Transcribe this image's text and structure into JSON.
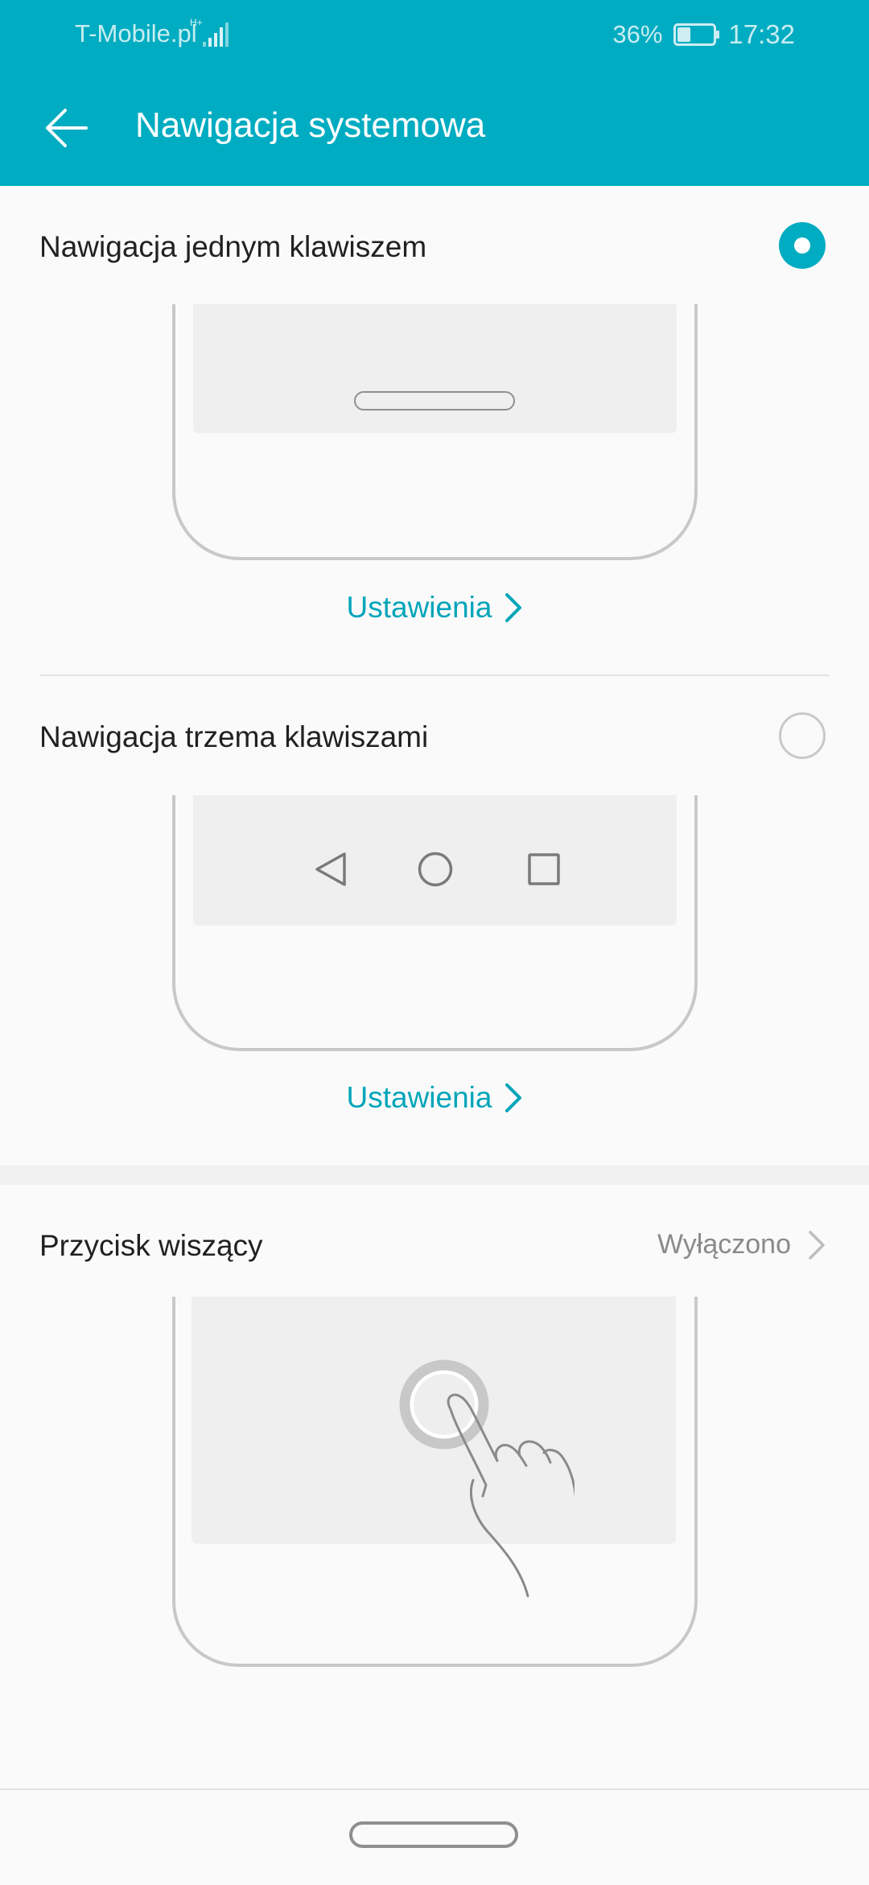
{
  "status_bar": {
    "carrier": "T-Mobile.pl",
    "network_type": "H+",
    "battery_percent": "36%",
    "battery_level": 0.36,
    "time": "17:32"
  },
  "app_bar": {
    "back_icon": "arrow-left-icon",
    "title": "Nawigacja systemowa"
  },
  "options": [
    {
      "label": "Nawigacja jednym klawiszem",
      "selected": true,
      "settings_label": "Ustawienia"
    },
    {
      "label": "Nawigacja trzema klawiszami",
      "selected": false,
      "settings_label": "Ustawienia"
    }
  ],
  "floating_button": {
    "label": "Przycisk wiszący",
    "value": "Wyłączono"
  },
  "colors": {
    "accent": "#00acc1",
    "link": "#00a5ba",
    "background": "#fafafa"
  },
  "icons": {
    "back": "arrow-left-icon",
    "settings_chevron": "chevron-right-icon",
    "nav_back": "triangle-back-icon",
    "nav_home": "circle-home-icon",
    "nav_recents": "square-recents-icon",
    "floating": "floating-button-icon",
    "hand": "hand-pointer-icon"
  }
}
